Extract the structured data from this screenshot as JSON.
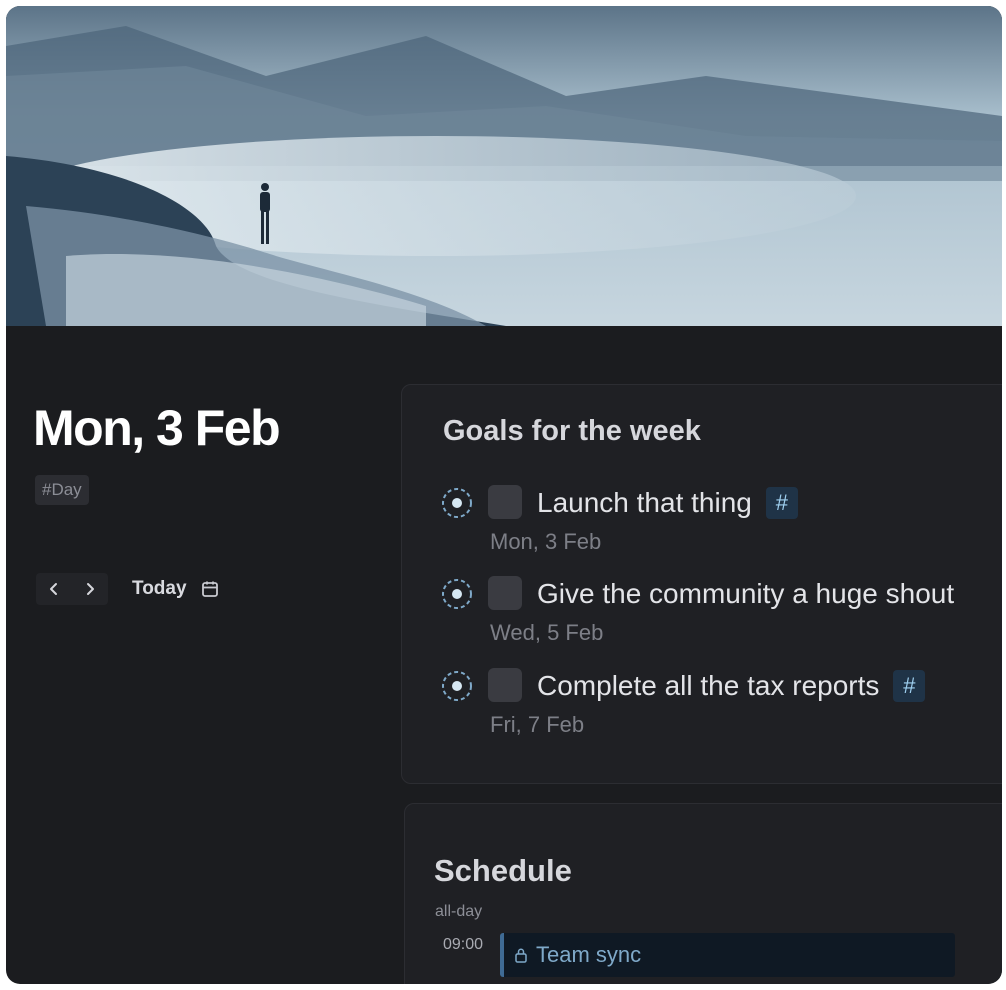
{
  "day": {
    "title": "Mon, 3 Feb",
    "tag": "#Day",
    "prev_icon": "chevron-left-icon",
    "next_icon": "chevron-right-icon",
    "today_label": "Today",
    "calendar_icon": "calendar-icon"
  },
  "goals": {
    "title": "Goals for the week",
    "items": [
      {
        "text": "Launch that thing",
        "date": "Mon, 3 Feb",
        "tag": "#"
      },
      {
        "text": "Give the community a huge shout",
        "date": "Wed, 5 Feb"
      },
      {
        "text": "Complete all the tax reports",
        "date": "Fri, 7 Feb",
        "tag": "#"
      }
    ]
  },
  "schedule": {
    "title": "Schedule",
    "allday_label": "all-day",
    "time": "09:00",
    "event_title": "Team sync",
    "event_icon": "lock-icon"
  },
  "colors": {
    "background": "#1b1c1f",
    "card": "#1f2024",
    "accent": "#9fd0f0",
    "event_bar": "#3f6b95"
  }
}
